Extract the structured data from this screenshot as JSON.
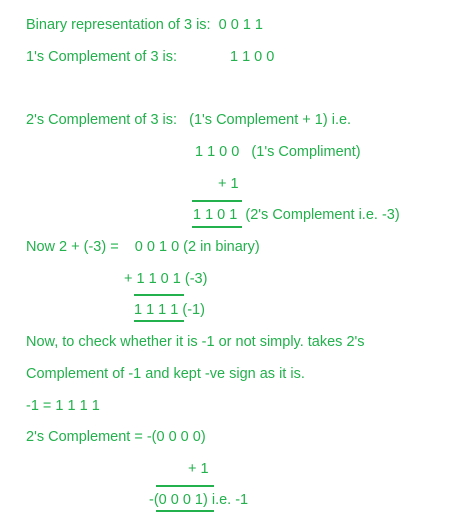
{
  "text_color": "#22b14c",
  "lines": [
    "Binary representation of 3 is:  0 0 1 1",
    "1's Complement of 3 is:",
    "1 1 0 0",
    "2's Complement of 3 is:   (1's Complement + 1) i.e.",
    "1 1 0 0   (1's Compliment)",
    "+ 1",
    "1 1 0 1  (2's Complement i.e. -3)",
    "Now 2 + (-3) =    0 0 1 0 (2 in binary)",
    "+ 1 1 0 1 (-3)",
    "1 1 1 1 (-1)",
    "Now, to check whether it is -1 or not simply. takes 2's",
    "Complement of -1 and kept -ve sign as it is.",
    "-1 = 1 1 1 1",
    "2's Complement = -(0 0 0 0)",
    "+ 1",
    "-(0 0 0 1) i.e. -1"
  ]
}
